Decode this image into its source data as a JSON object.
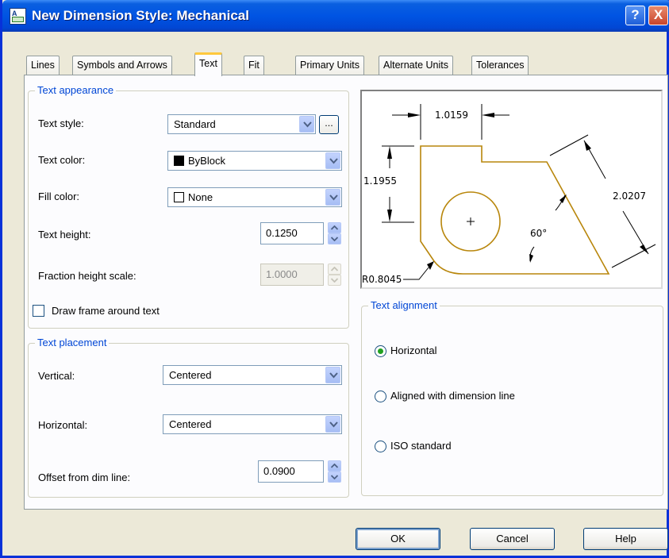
{
  "window": {
    "title": "New Dimension Style: Mechanical",
    "help_label": "?",
    "close_label": "X"
  },
  "tabs": [
    {
      "label": "Lines"
    },
    {
      "label": "Symbols and Arrows"
    },
    {
      "label": "Text"
    },
    {
      "label": "Fit"
    },
    {
      "label": "Primary Units"
    },
    {
      "label": "Alternate Units"
    },
    {
      "label": "Tolerances"
    }
  ],
  "active_tab": "Text",
  "text_appearance": {
    "title": "Text appearance",
    "text_style_label": "Text style:",
    "text_style_value": "Standard",
    "ellipsis_label": "...",
    "text_color_label": "Text color:",
    "text_color_value": "ByBlock",
    "fill_color_label": "Fill color:",
    "fill_color_value": "None",
    "text_height_label": "Text height:",
    "text_height_value": "0.1250",
    "fraction_label": "Fraction height scale:",
    "fraction_value": "1.0000",
    "draw_frame_label": "Draw frame around text",
    "draw_frame_checked": false
  },
  "text_placement": {
    "title": "Text placement",
    "vertical_label": "Vertical:",
    "vertical_value": "Centered",
    "horizontal_label": "Horizontal:",
    "horizontal_value": "Centered",
    "offset_label": "Offset from dim line:",
    "offset_value": "0.0900"
  },
  "preview": {
    "dim_top": "1.0159",
    "dim_left": "1.1955",
    "dim_right": "2.0207",
    "angle": "60°",
    "radius": "R0.8045"
  },
  "text_alignment": {
    "title": "Text alignment",
    "options": [
      {
        "label": "Horizontal",
        "selected": true
      },
      {
        "label": "Aligned with dimension line",
        "selected": false
      },
      {
        "label": "ISO standard",
        "selected": false
      }
    ]
  },
  "buttons": {
    "ok": "OK",
    "cancel": "Cancel",
    "help": "Help"
  },
  "colors": {
    "title_bar": "#0054e3",
    "group_title": "#0046d5",
    "active_tab_accent": "#ffc83c",
    "preview_shape": "#b8860b",
    "radio_selected": "#21a121"
  }
}
